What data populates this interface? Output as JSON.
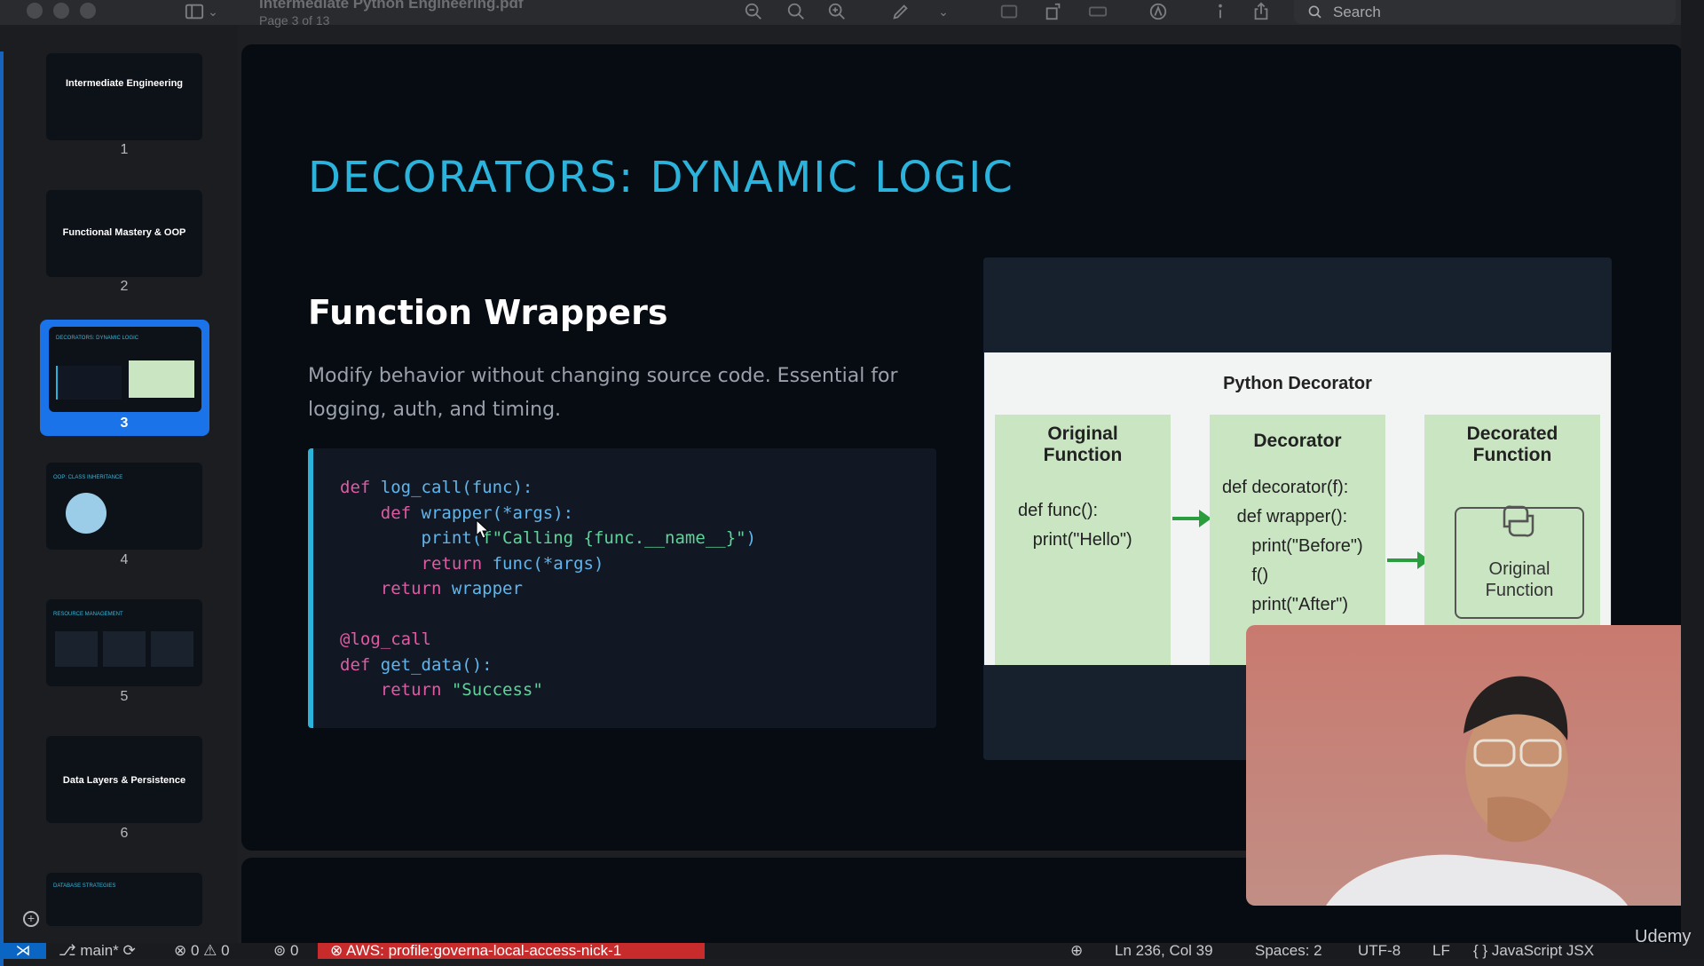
{
  "toolbar": {
    "doc_title": "Intermediate Python Engineering.pdf",
    "page_indicator": "Page 3 of 13",
    "search_label": "Search"
  },
  "sidebar": {
    "thumbnails": [
      {
        "num": "1",
        "title": "Intermediate Engineering"
      },
      {
        "num": "2",
        "title": "Functional Mastery & OOP"
      },
      {
        "num": "3",
        "title": "DECORATORS: DYNAMIC LOGIC"
      },
      {
        "num": "4",
        "title": "OOP: CLASS INHERITANCE"
      },
      {
        "num": "5",
        "title": "RESOURCE MANAGEMENT"
      },
      {
        "num": "6",
        "title": "Data Layers & Persistence"
      },
      {
        "num": "",
        "title": "DATABASE STRATEGIES"
      }
    ],
    "selected": "3"
  },
  "slide": {
    "title": "DECORATORS: DYNAMIC LOGIC",
    "subtitle": "Function Wrappers",
    "description": "Modify behavior without changing source code. Essential for logging, auth, and timing.",
    "code_lines": [
      "def log_call(func):",
      "    def wrapper(*args):",
      "        print(f\"Calling {func.__name__}\")",
      "        return func(*args)",
      "    return wrapper",
      "",
      "@log_call",
      "def get_data():",
      "    return \"Success\""
    ],
    "diagram": {
      "title": "Python Decorator",
      "col1_header": "Original Function",
      "col1_code": "def func():\n   print(\"Hello\")",
      "col2_header": "Decorator",
      "col2_code": "def decorator(f):\n   def wrapper():\n      print(\"Before\")\n      f()\n      print(\"After\")",
      "col3_header": "Decorated Function",
      "col3_box": "Original Function"
    }
  },
  "statusbar": {
    "branch": "main*",
    "problems": "⊗ 0 ⚠ 0",
    "ports": "0",
    "aws": "AWS: profile:governa-local-access-nick-1",
    "cursor_pos": "Ln 236, Col 39",
    "spaces": "Spaces: 2",
    "encoding": "UTF-8",
    "eol": "LF",
    "language": "JavaScript JSX"
  },
  "watermark": "Udemy",
  "colors": {
    "accent": "#2bb3dc",
    "selection": "#1a73e8",
    "aws_bg": "#c72b2b"
  }
}
